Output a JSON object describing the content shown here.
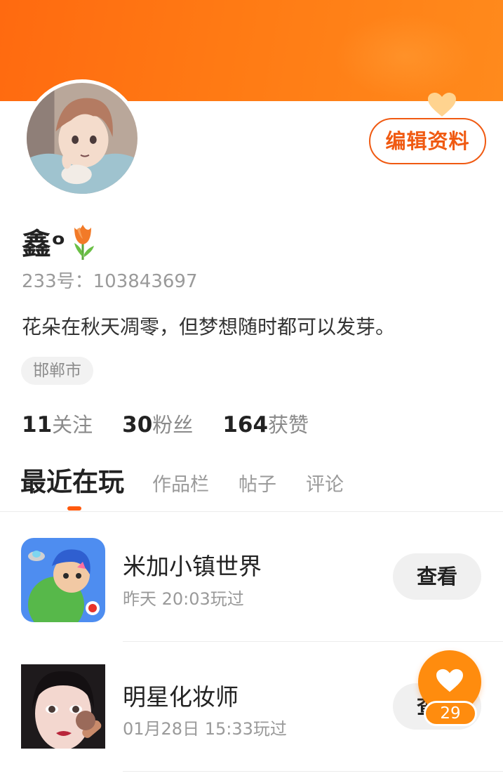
{
  "header": {
    "edit_button_label": "编辑资料",
    "banner_color": "#ff7412"
  },
  "profile": {
    "name": "鑫ᵒ",
    "name_emoji": "tulip-icon",
    "id_text": "233号：103843697",
    "bio": "花朵在秋天凋零，但梦想随时都可以发芽。",
    "location": "邯郸市"
  },
  "stats": [
    {
      "value": "11",
      "label": "关注"
    },
    {
      "value": "30",
      "label": "粉丝"
    },
    {
      "value": "164",
      "label": "获赞"
    }
  ],
  "tabs": [
    {
      "label": "最近在玩",
      "active": true
    },
    {
      "label": "作品栏",
      "active": false
    },
    {
      "label": "帖子",
      "active": false
    },
    {
      "label": "评论",
      "active": false
    }
  ],
  "recent_games": [
    {
      "title": "米加小镇世界",
      "played": "昨天 20:03玩过",
      "button": "查看",
      "icon": "miga-town-icon"
    },
    {
      "title": "明星化妆师",
      "played": "01月28日 15:33玩过",
      "button": "查看",
      "icon": "star-makeup-icon"
    }
  ],
  "like_widget": {
    "count": "29",
    "icon": "heart-icon"
  },
  "colors": {
    "accent": "#f05a12",
    "fab": "#ff8c0e"
  }
}
